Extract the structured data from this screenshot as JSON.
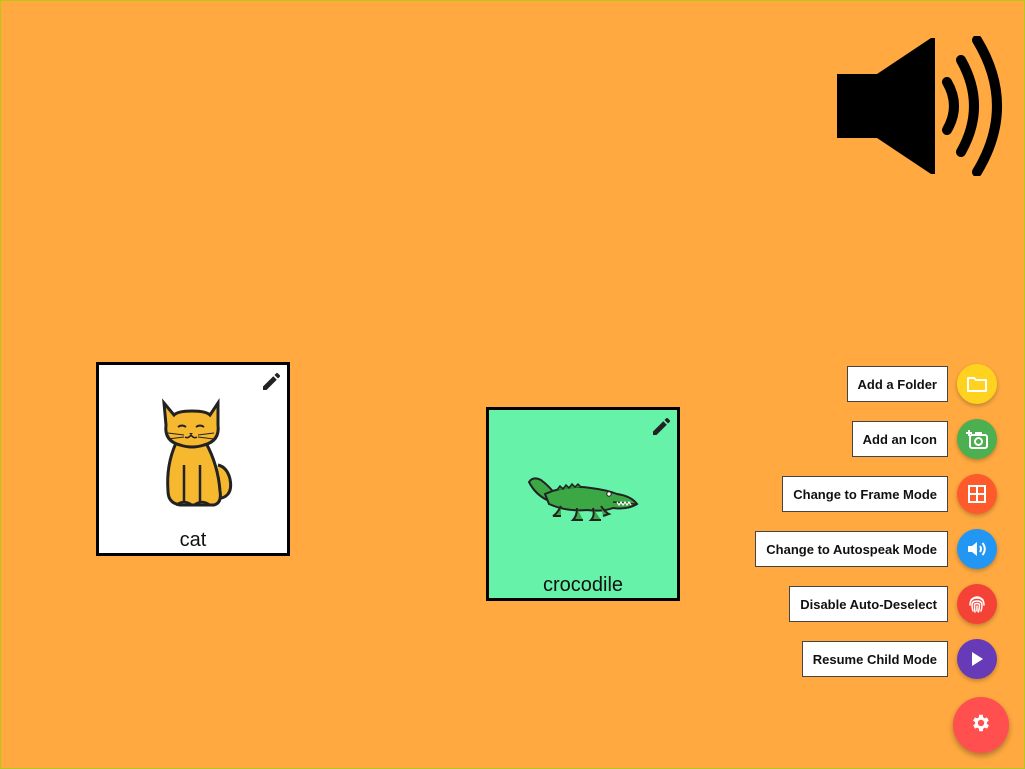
{
  "speaker": {
    "icon": "volume-up-icon",
    "color": "#000000"
  },
  "cards": [
    {
      "label": "cat",
      "background": "#FFFFFF",
      "icon": "cat-icon",
      "edit_icon": "pencil-icon"
    },
    {
      "label": "crocodile",
      "background": "#67F2AA",
      "icon": "crocodile-icon",
      "edit_icon": "pencil-icon"
    }
  ],
  "menu": {
    "items": [
      {
        "label": "Add a Folder",
        "icon": "folder-icon",
        "color": "#FFD21F"
      },
      {
        "label": "Add an Icon",
        "icon": "add-photo-icon",
        "color": "#4CAF50"
      },
      {
        "label": "Change to Frame Mode",
        "icon": "grid-icon",
        "color": "#FF5A2B"
      },
      {
        "label": "Change to Autospeak Mode",
        "icon": "volume-icon",
        "color": "#2196F3"
      },
      {
        "label": "Disable Auto-Deselect",
        "icon": "fingerprint-icon",
        "color": "#F44336"
      },
      {
        "label": "Resume Child Mode",
        "icon": "play-icon",
        "color": "#673AB7"
      }
    ]
  },
  "fab": {
    "icon": "gear-icon",
    "color": "#FF4F4F"
  },
  "background_color": "#FFA940"
}
